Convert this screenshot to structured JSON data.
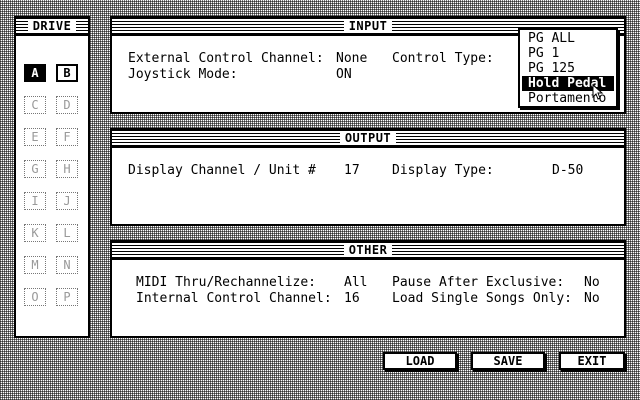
{
  "drive": {
    "title": "DRIVE",
    "buttons": [
      {
        "label": "A",
        "state": "selected"
      },
      {
        "label": "B",
        "state": "enabled"
      },
      {
        "label": "C",
        "state": "disabled"
      },
      {
        "label": "D",
        "state": "disabled"
      },
      {
        "label": "E",
        "state": "disabled"
      },
      {
        "label": "F",
        "state": "disabled"
      },
      {
        "label": "G",
        "state": "disabled"
      },
      {
        "label": "H",
        "state": "disabled"
      },
      {
        "label": "I",
        "state": "disabled"
      },
      {
        "label": "J",
        "state": "disabled"
      },
      {
        "label": "K",
        "state": "disabled"
      },
      {
        "label": "L",
        "state": "disabled"
      },
      {
        "label": "M",
        "state": "disabled"
      },
      {
        "label": "N",
        "state": "disabled"
      },
      {
        "label": "O",
        "state": "disabled"
      },
      {
        "label": "P",
        "state": "disabled"
      }
    ]
  },
  "input": {
    "title": "INPUT",
    "ext_channel_label": "External Control Channel:",
    "ext_channel_value": "None",
    "control_type_label": "Control Type:",
    "joystick_label": "Joystick Mode:",
    "joystick_value": "ON"
  },
  "dropdown": {
    "options": [
      "PG ALL",
      "PG 1",
      "PG 125",
      "Hold Pedal",
      "Portamento"
    ],
    "highlighted": "Hold Pedal"
  },
  "output": {
    "title": "OUTPUT",
    "display_channel_label": "Display Channel / Unit #",
    "display_channel_value": "17",
    "display_type_label": "Display Type:",
    "display_type_value": "D-50"
  },
  "other": {
    "title": "OTHER",
    "midi_thru_label": "MIDI Thru/Rechannelize:",
    "midi_thru_value": "All",
    "internal_channel_label": "Internal Control Channel:",
    "internal_channel_value": "16",
    "pause_label": "Pause After Exclusive:",
    "pause_value": "No",
    "load_single_label": "Load Single Songs Only:",
    "load_single_value": "No"
  },
  "buttons": {
    "load": "LOAD",
    "save": "SAVE",
    "exit": "EXIT"
  }
}
